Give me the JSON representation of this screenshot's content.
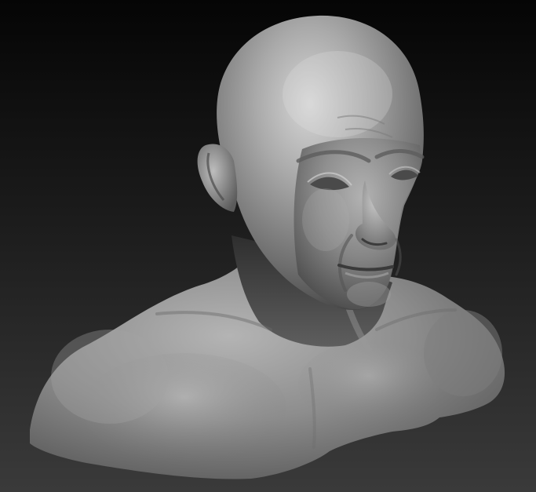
{
  "viewport": {
    "background_top": "#050505",
    "background_bottom": "#3a3a3a",
    "material_color": "#8c8c8c"
  },
  "model": {
    "subject": "sculpted-bust-bald-male"
  }
}
